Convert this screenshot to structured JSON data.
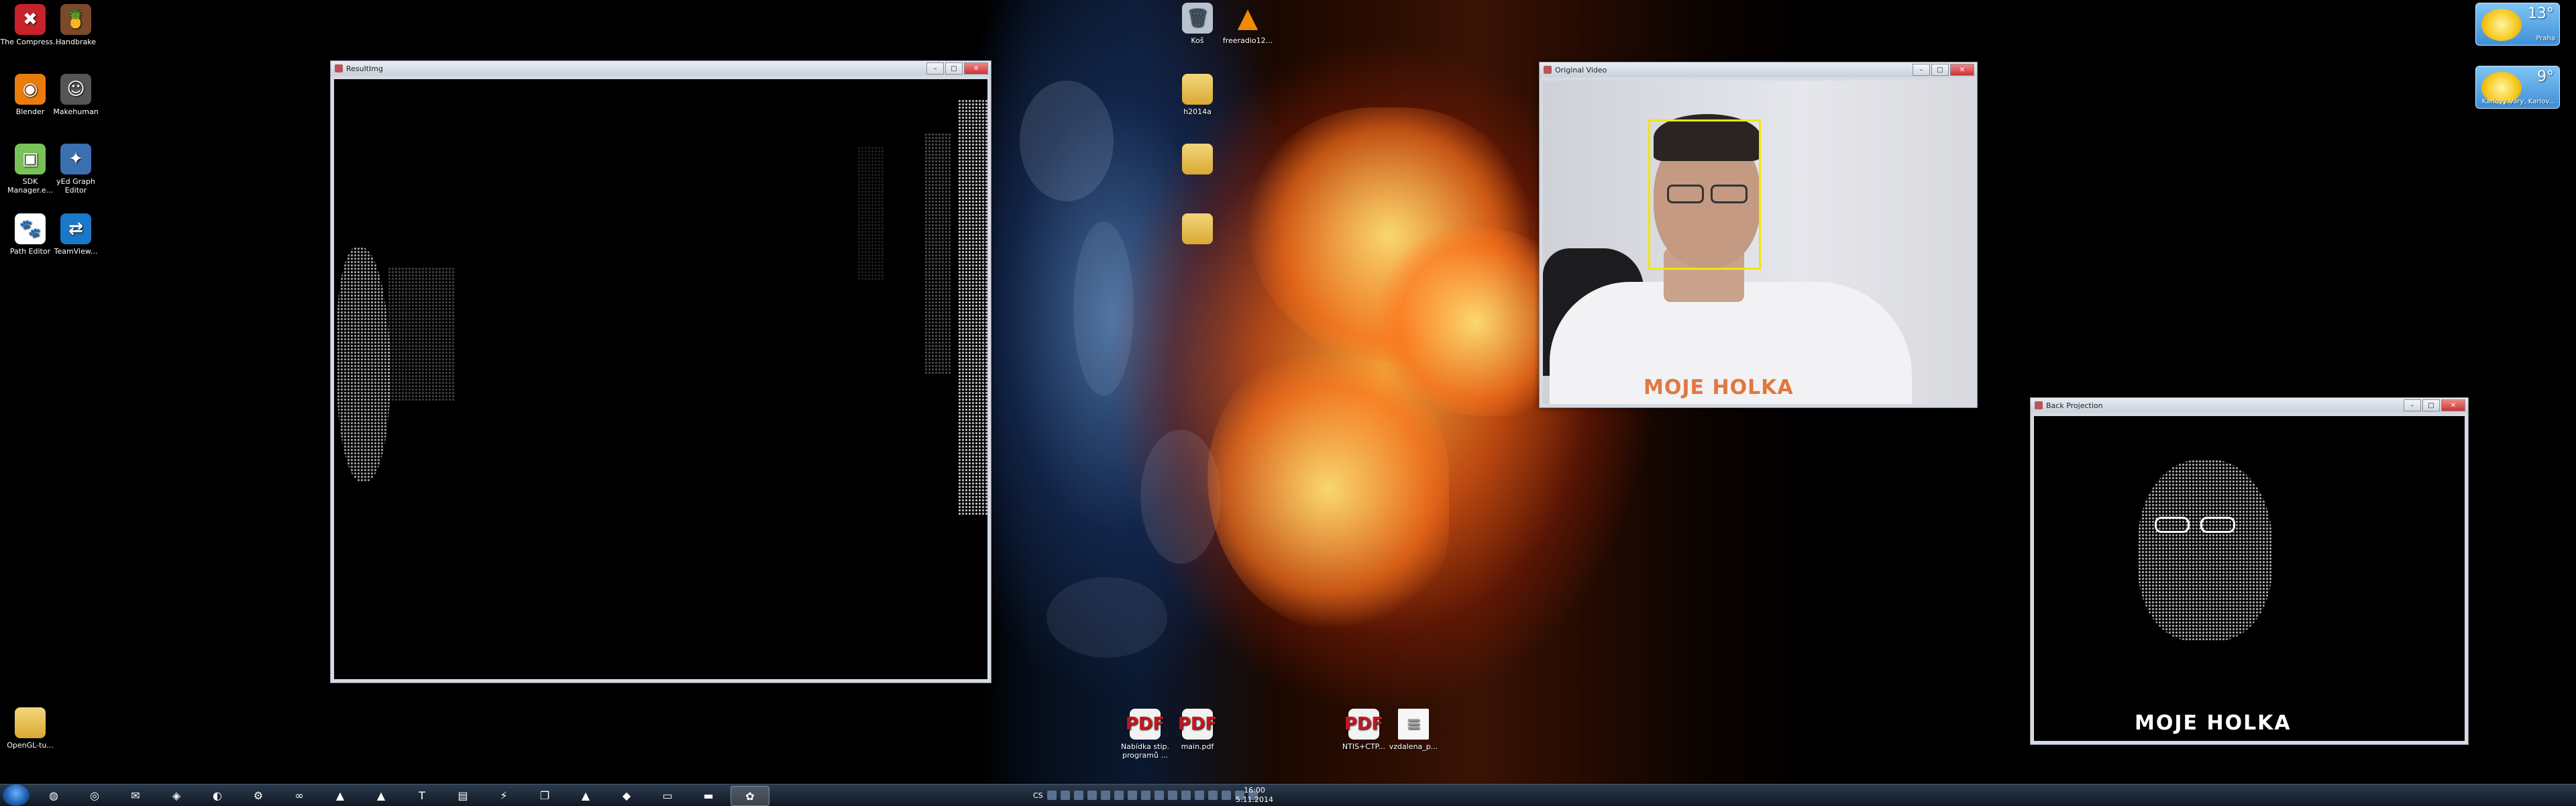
{
  "desktop_icons": [
    {
      "label": "The Compress...",
      "icon": "compress-icon"
    },
    {
      "label": "Handbrake",
      "icon": "handbrake-icon"
    },
    {
      "label": "Blender",
      "icon": "blender-icon"
    },
    {
      "label": "Makehuman",
      "icon": "makehuman-icon"
    },
    {
      "label": "SDK Manager.e...",
      "icon": "android-icon"
    },
    {
      "label": "yEd Graph Editor",
      "icon": "yed-icon"
    },
    {
      "label": "Path Editor",
      "icon": "paw-icon"
    },
    {
      "label": "TeamView...",
      "icon": "teamviewer-icon"
    },
    {
      "label": "OpenGL-tu...",
      "icon": "folder-icon"
    }
  ],
  "desktop_icons_top": [
    {
      "label": "Koš",
      "icon": "recycle-bin-icon"
    },
    {
      "label": "freeradio12...",
      "icon": "vlc-icon"
    },
    {
      "label": "h2014a",
      "icon": "folder-icon"
    },
    {
      "label": "",
      "icon": "folder-icon"
    },
    {
      "label": "",
      "icon": "folder-icon"
    }
  ],
  "desktop_icons_bottom": [
    {
      "label": "Nabídka stip. programů ...",
      "icon": "pdf-icon"
    },
    {
      "label": "main.pdf",
      "icon": "pdf-icon"
    },
    {
      "label": "NTIS+CTP...",
      "icon": "pdf-icon"
    },
    {
      "label": "vzdalena_p...",
      "icon": "document-icon"
    }
  ],
  "windows": {
    "result": {
      "title": "ResultImg"
    },
    "original": {
      "title": "Original Video",
      "shirt_text": "MOJE HOLKA"
    },
    "backproj": {
      "title": "Back Projection",
      "shirt_text": "MOJE HOLKA"
    }
  },
  "window_controls": {
    "minimize": "–",
    "maximize": "□",
    "close": "✕"
  },
  "weather": [
    {
      "temp": "13°",
      "location": "Praha"
    },
    {
      "temp": "9°",
      "location": "Karlovy Vary, Karlov..."
    }
  ],
  "taskbar": {
    "items": [
      "firefox-icon",
      "chrome-icon",
      "outlook-icon",
      "explorer-icon",
      "eclipse-icon",
      "settings-icon",
      "visual-studio-icon",
      "matlab-icon",
      "vlc-icon",
      "texmaker-icon",
      "terminal-icon",
      "network-icon",
      "copy-icon",
      "inkscape-icon",
      "git-icon",
      "console-icon",
      "cmd-icon",
      "opencv-app-icon"
    ],
    "active_index": 17,
    "lang": "CS",
    "clock_time": "16:00",
    "clock_date": "5.11.2014"
  },
  "colors": {
    "face_box": "#f2e600",
    "window_frame": "#d6dbe3",
    "taskbar": "#101925"
  }
}
